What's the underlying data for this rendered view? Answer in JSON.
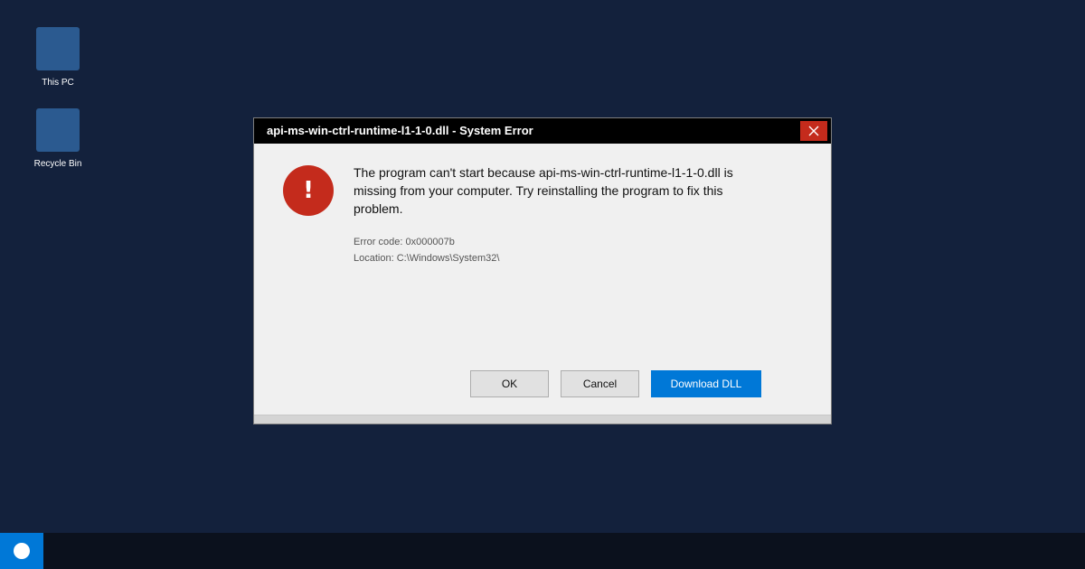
{
  "desktop": {
    "icons": [
      {
        "label": "This PC"
      },
      {
        "label": "Recycle Bin"
      }
    ]
  },
  "dialog": {
    "title": "api-ms-win-ctrl-runtime-l1-1-0.dll - System Error",
    "close_icon": "close-icon",
    "error_icon": "error-icon",
    "error_glyph": "!",
    "message": "The program can't start because api-ms-win-ctrl-runtime-l1-1-0.dll is missing from your computer. Try reinstalling the program to fix this problem.",
    "error_code": "Error code: 0x000007b",
    "location": "Location: C:\\Windows\\System32\\",
    "buttons": {
      "ok": "OK",
      "cancel": "Cancel",
      "download": "Download DLL"
    }
  },
  "taskbar": {
    "start_icon": "start-icon"
  },
  "colors": {
    "desktop_bg": "#13213c",
    "titlebar_bg": "#000000",
    "close_bg": "#c42b1c",
    "error_icon_bg": "#c42b1c",
    "accent": "#0078d7",
    "dialog_bg": "#f0f0f0",
    "taskbar_bg": "#0b111d"
  }
}
